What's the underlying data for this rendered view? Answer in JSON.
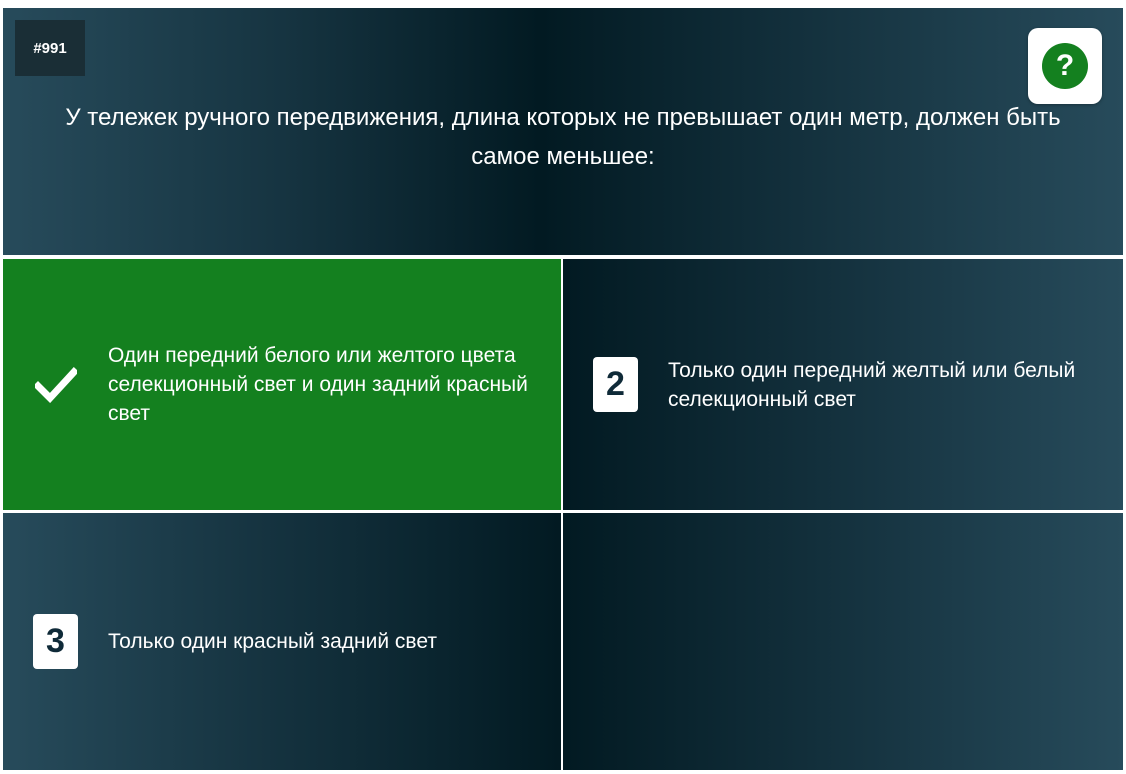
{
  "question": {
    "number": "#991",
    "text": "У тележек ручного передвижения, длина которых не превышает один метр, должен быть самое меньшее:",
    "help_label": "?"
  },
  "answers": [
    {
      "badge": "",
      "state": "correct",
      "text": "Один передний белого или желтого цвета селекционный свет и один задний красный свет"
    },
    {
      "badge": "2",
      "state": "default",
      "text": "Только один передний желтый или белый селекционный свет"
    },
    {
      "badge": "3",
      "state": "default",
      "text": "Только один красный задний свет"
    }
  ],
  "icons": {
    "correct": "checkmark-icon",
    "help": "question-mark-icon"
  },
  "colors": {
    "correct_bg": "#14801f",
    "panel_dark": "#021a22",
    "panel_light": "#274b5b"
  }
}
